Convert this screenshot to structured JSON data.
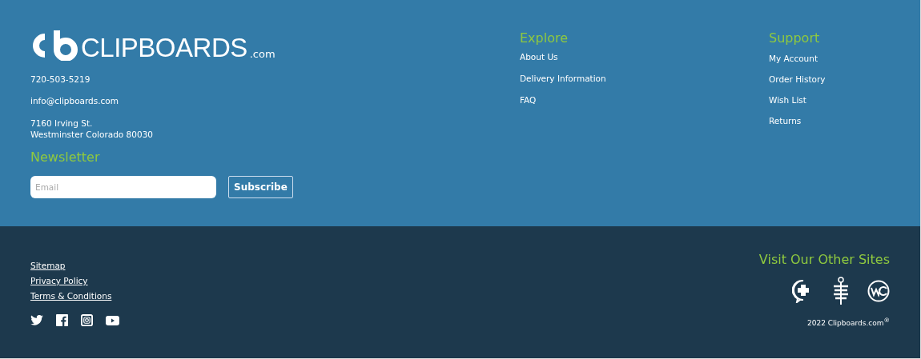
{
  "brand": {
    "name": "CLIPBOARDS",
    "suffix": ".com"
  },
  "contact": {
    "phone": "720-503-5219",
    "email": "info@clipboards.com",
    "address": [
      "7160 Irving St.",
      "Westminster Colorado 80030"
    ]
  },
  "newsletter": {
    "title": "Newsletter",
    "placeholder": "Email",
    "button": "Subscribe"
  },
  "columns": [
    {
      "title": "Explore",
      "links": [
        "About Us",
        "Delivery Information",
        "FAQ"
      ]
    },
    {
      "title": "Support",
      "links": [
        "My Account",
        "Order History",
        "Wish List",
        "Returns"
      ]
    }
  ],
  "legal_links": [
    "Sitemap",
    "Privacy Policy",
    "Terms & Conditions"
  ],
  "other_sites": {
    "title": "Visit Our Other Sites"
  },
  "copyright": "2022 Clipboards.com$^{®}$"
}
